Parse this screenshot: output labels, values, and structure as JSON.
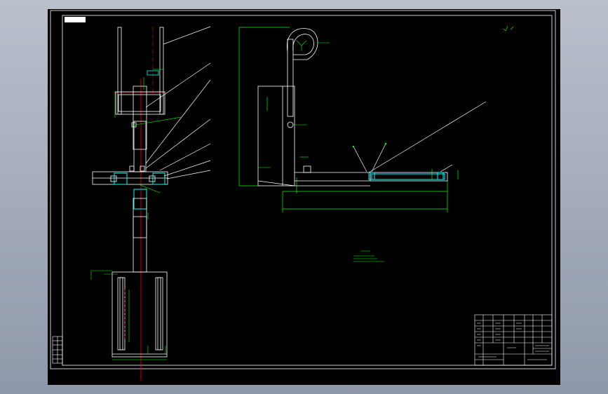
{
  "sheet": {
    "title_tag": "",
    "tech_note_title": "",
    "tech_note_lines": [
      "",
      "",
      ""
    ]
  },
  "colors": {
    "background": "#000000",
    "outline": "#ffffff",
    "dimension": "#00ff00",
    "centerline": "#ff0000",
    "highlight": "#00ffff",
    "workspace": "#9aa3b4"
  }
}
